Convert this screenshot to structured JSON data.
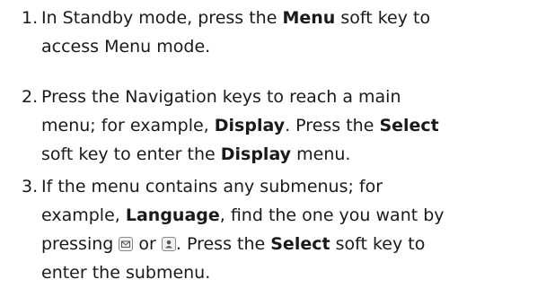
{
  "steps": [
    {
      "number": "1.",
      "line1": {
        "t1": "In Standby mode, press the ",
        "b1": "Menu",
        "t2": " soft key to"
      },
      "line2": {
        "t1": "access Menu mode."
      }
    },
    {
      "number": "2.",
      "line1": {
        "t1": "Press the Navigation keys to reach a main"
      },
      "line2": {
        "t1": "menu; for example, ",
        "b1": "Display",
        "t2": ". Press the ",
        "b2": "Select"
      },
      "line3": {
        "t1": "soft key to enter the ",
        "b1": "Display",
        "t2": " menu."
      }
    },
    {
      "number": "3.",
      "line1": {
        "t1": "If the menu contains any submenus; for"
      },
      "line2": {
        "t1": "example, ",
        "b1": "Language",
        "t2": ", find the one you want by"
      },
      "line3": {
        "t1": "pressing ",
        "t2": " or ",
        "t3": ". Press the ",
        "b1": "Select",
        "t4": " soft key to"
      },
      "line4": {
        "t1": "enter the submenu."
      },
      "icons": [
        "envelope-key-icon",
        "phonebook-key-icon"
      ]
    }
  ]
}
